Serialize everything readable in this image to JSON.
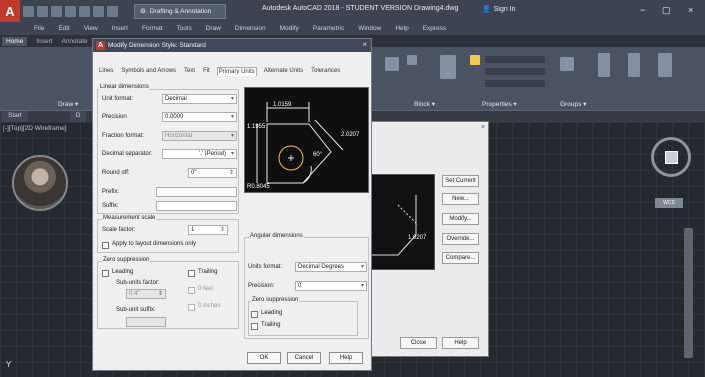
{
  "titlebar": {
    "logo": "A",
    "workspace": "Drafting & Annotation",
    "title": "Autodesk AutoCAD 2018 - STUDENT VERSION Drawing4.dwg",
    "signin": "Sign In",
    "min": "−",
    "max": "▢",
    "close": "×"
  },
  "menubar": [
    "File",
    "Edit",
    "View",
    "Insert",
    "Format",
    "Tools",
    "Draw",
    "Dimension",
    "Modify",
    "Parametric",
    "Window",
    "Help",
    "Express"
  ],
  "ribbon_tabs": [
    "Home",
    "Insert",
    "Annotate"
  ],
  "ribbon": {
    "draw": "Draw ▾",
    "block": "Block ▾",
    "properties": "Properties ▾",
    "groups": "Groups ▾"
  },
  "file_tabs": [
    "Start",
    "D"
  ],
  "viewport_label": "[-][Top][2D Wireframe]",
  "y_axis": "Y",
  "wcs": "WCS",
  "manager": {
    "buttons": [
      "Set Current",
      "New...",
      "Modify...",
      "Override...",
      "Compare..."
    ],
    "close": "Close",
    "help": "Help",
    "preview_dim": "1.0207"
  },
  "dialog": {
    "title": "Modify Dimension Style: Standard",
    "tabs": [
      "Lines",
      "Symbols and Arrows",
      "Text",
      "Fit",
      "Primary Units",
      "Alternate Units",
      "Tolerances"
    ],
    "linear_group": "Linear dimensions",
    "unit_format_label": "Unit format:",
    "unit_format": "Decimal",
    "precision_label": "Precision",
    "precision": "0.0000",
    "fraction_label": "Fraction format:",
    "fraction": "Horizontal",
    "decimal_sep_label": "Decimal separator:",
    "decimal_sep": "'.' (Period)",
    "round_label": "Round off:",
    "round": "0\"",
    "prefix_label": "Prefix:",
    "suffix_label": "Suffix:",
    "measure_group": "Measurement scale",
    "scale_label": "Scale factor:",
    "scale": "1",
    "apply_layout": "Apply to layout dimensions only",
    "zero_group": "Zero suppression",
    "leading": "Leading",
    "trailing": "Trailing",
    "subunits_factor_label": "Sub-units factor:",
    "subunits_factor": "0.4\"",
    "feet": "0 feet",
    "inches": "0 inches",
    "subunit_suffix_label": "Sub-unit suffix:",
    "angular_group": "Angular dimensions",
    "ang_units_label": "Units format:",
    "ang_units": "Decimal Degrees",
    "ang_precision_label": "Precision:",
    "ang_precision": "0",
    "ang_zero_group": "Zero suppression",
    "ang_leading": "Leading",
    "ang_trailing": "Trailing",
    "ok": "OK",
    "cancel": "Cancel",
    "help": "Help",
    "preview": {
      "top": "1.0159",
      "left": "1.1955",
      "right": "2.0207",
      "angle": "60°",
      "radius": "R0.8045"
    }
  }
}
